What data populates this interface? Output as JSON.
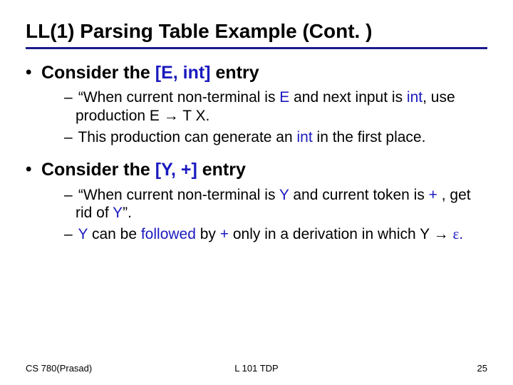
{
  "title": "LL(1) Parsing Table Example (Cont. )",
  "bullet1": {
    "prefix": "Consider the ",
    "entry": "[E, int]",
    "suffix": " entry",
    "sub1_a": "“When current non-terminal is ",
    "sub1_b": "E",
    "sub1_c": " and next input is ",
    "sub1_d": "int",
    "sub1_e": ", use production  E ",
    "sub1_arrow": "→",
    "sub1_f": " T X.",
    "sub2_a": "This production can generate an ",
    "sub2_b": "int",
    "sub2_c": " in the first place."
  },
  "bullet2": {
    "prefix": "Consider the ",
    "entry": "[Y, +]",
    "suffix": " entry",
    "sub1_a": "“When current non-terminal is ",
    "sub1_b": "Y",
    "sub1_c": " and current token is ",
    "sub1_d": "+",
    "sub1_e": " , get rid of ",
    "sub1_f": "Y",
    "sub1_g": "”.",
    "sub2_a": "Y",
    "sub2_b": " can be ",
    "sub2_c": "followed",
    "sub2_d": " by ",
    "sub2_e": "+",
    "sub2_f": " only in a derivation in which Y ",
    "sub2_arrow": "→",
    "sub2_g": " ",
    "sub2_eps": "ε",
    "sub2_h": "."
  },
  "footer": {
    "left": "CS 780(Prasad)",
    "center": "L 101 TDP",
    "right": "25"
  }
}
